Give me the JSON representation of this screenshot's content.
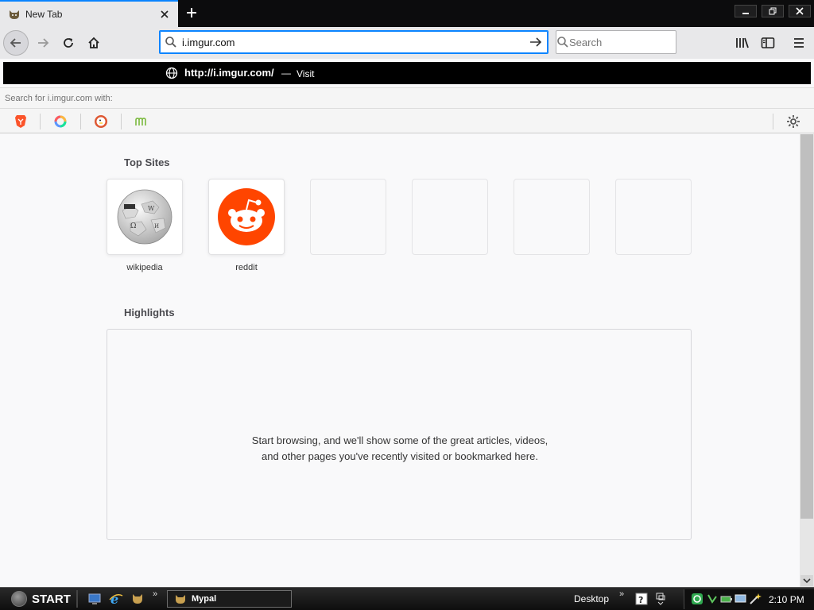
{
  "tab": {
    "title": "New Tab",
    "favicon": "cat-icon"
  },
  "urlbar": {
    "value": "i.imgur.com"
  },
  "searchbar": {
    "placeholder": "Search"
  },
  "dropdown": {
    "url": "http://i.imgur.com/",
    "dash": "—",
    "action": "Visit",
    "search_with": "Search for i.imgur.com with:",
    "engines": [
      "brave-icon",
      "qwant-icon",
      "duckduckgo-icon",
      "mojeek-icon"
    ]
  },
  "top_sites": {
    "title": "Top Sites",
    "tiles": [
      {
        "label": "wikipedia",
        "icon": "wikipedia-globe-icon"
      },
      {
        "label": "reddit",
        "icon": "reddit-alien-icon"
      },
      {
        "label": ""
      },
      {
        "label": ""
      },
      {
        "label": ""
      },
      {
        "label": ""
      }
    ]
  },
  "highlights": {
    "title": "Highlights",
    "message": "Start browsing, and we'll show some of the great articles, videos, and other pages you've recently visited or bookmarked here."
  },
  "taskbar": {
    "start_label": "START",
    "task_label": "Mypal",
    "desktop_label": "Desktop",
    "chevron": "»",
    "clock": "2:10 PM"
  },
  "colors": {
    "accent": "#0a84ff",
    "reddit": "#ff4500",
    "titlebar": "#0c0c0d"
  }
}
